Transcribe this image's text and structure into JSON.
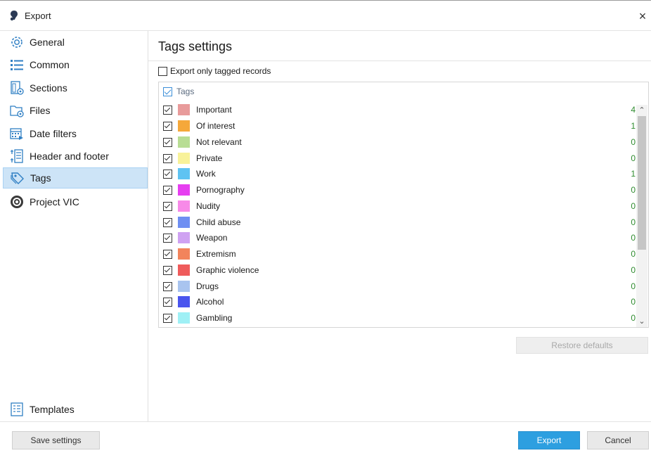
{
  "window": {
    "title": "Export",
    "close_glyph": "×"
  },
  "sidebar": {
    "items": [
      {
        "label": "General",
        "icon": "gear-icon",
        "active": false
      },
      {
        "label": "Common",
        "icon": "list-icon",
        "active": false
      },
      {
        "label": "Sections",
        "icon": "sections-icon",
        "active": false
      },
      {
        "label": "Files",
        "icon": "files-icon",
        "active": false
      },
      {
        "label": "Date filters",
        "icon": "calendar-icon",
        "active": false
      },
      {
        "label": "Header and footer",
        "icon": "header-footer-icon",
        "active": false
      },
      {
        "label": "Tags",
        "icon": "tag-icon",
        "active": true
      },
      {
        "label": "Project VIC",
        "icon": "project-vic-icon",
        "active": false
      }
    ],
    "templates_label": "Templates"
  },
  "main": {
    "title": "Tags settings",
    "export_only_tagged": {
      "label": "Export only tagged records",
      "checked": false
    },
    "tags_header": "Tags",
    "tags": [
      {
        "name": "Important",
        "color": "#e89b9b",
        "count": "4",
        "checked": true
      },
      {
        "name": "Of interest",
        "color": "#f5a83a",
        "count": "1",
        "checked": true
      },
      {
        "name": "Not relevant",
        "color": "#b8dd94",
        "count": "0",
        "checked": true
      },
      {
        "name": "Private",
        "color": "#f8f29a",
        "count": "0",
        "checked": true
      },
      {
        "name": "Work",
        "color": "#5fc3f2",
        "count": "1",
        "checked": true
      },
      {
        "name": "Pornography",
        "color": "#e63ff0",
        "count": "0",
        "checked": true
      },
      {
        "name": "Nudity",
        "color": "#f78ae8",
        "count": "0",
        "checked": true
      },
      {
        "name": "Child abuse",
        "color": "#6f8ff2",
        "count": "0",
        "checked": true
      },
      {
        "name": "Weapon",
        "color": "#cfa2f2",
        "count": "0",
        "checked": true
      },
      {
        "name": "Extremism",
        "color": "#f2845c",
        "count": "0",
        "checked": true
      },
      {
        "name": "Graphic violence",
        "color": "#ef5b5b",
        "count": "0",
        "checked": true
      },
      {
        "name": "Drugs",
        "color": "#a9c4ef",
        "count": "0",
        "checked": true
      },
      {
        "name": "Alcohol",
        "color": "#4a55ee",
        "count": "0",
        "checked": true
      },
      {
        "name": "Gambling",
        "color": "#9ff0f5",
        "count": "0",
        "checked": true
      }
    ],
    "restore_label": "Restore defaults"
  },
  "footer": {
    "save_label": "Save settings",
    "export_label": "Export",
    "cancel_label": "Cancel"
  },
  "colors": {
    "accent": "#2d9fe0",
    "active_nav_bg": "#cde4f7",
    "count_green": "#2e8b2e"
  }
}
